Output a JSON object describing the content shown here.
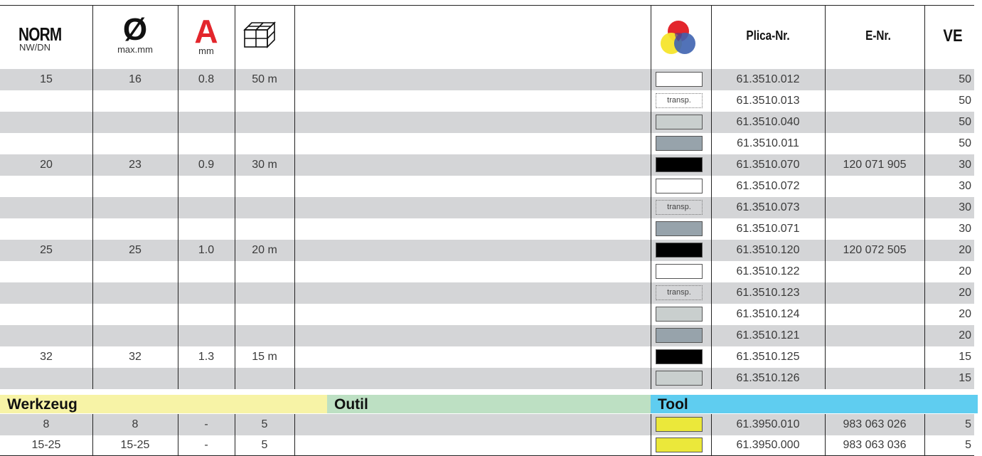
{
  "header": {
    "norm": "NORM",
    "norm_sub": "NW/DN",
    "diameter_symbol": "Ø",
    "diameter_sub": "max.mm",
    "wall_symbol": "A",
    "wall_sub": "mm",
    "length_icon": "box-icon",
    "color_icon": "color-circles-icon",
    "plica": "Plica-Nr.",
    "enr": "E-Nr.",
    "ve": "VE"
  },
  "rows": [
    {
      "nw": "15",
      "max": "16",
      "a": "0.8",
      "len": "50 m",
      "color": "white",
      "plica": "61.3510.012",
      "enr": "",
      "ve": "50"
    },
    {
      "nw": "",
      "max": "",
      "a": "",
      "len": "",
      "color": "transp.",
      "plica": "61.3510.013",
      "enr": "",
      "ve": "50"
    },
    {
      "nw": "",
      "max": "",
      "a": "",
      "len": "",
      "color": "light-grey",
      "plica": "61.3510.040",
      "enr": "",
      "ve": "50"
    },
    {
      "nw": "",
      "max": "",
      "a": "",
      "len": "",
      "color": "grey",
      "plica": "61.3510.011",
      "enr": "",
      "ve": "50"
    },
    {
      "nw": "20",
      "max": "23",
      "a": "0.9",
      "len": "30 m",
      "color": "black",
      "plica": "61.3510.070",
      "enr": "120 071 905",
      "ve": "30"
    },
    {
      "nw": "",
      "max": "",
      "a": "",
      "len": "",
      "color": "white",
      "plica": "61.3510.072",
      "enr": "",
      "ve": "30"
    },
    {
      "nw": "",
      "max": "",
      "a": "",
      "len": "",
      "color": "transp.",
      "plica": "61.3510.073",
      "enr": "",
      "ve": "30"
    },
    {
      "nw": "",
      "max": "",
      "a": "",
      "len": "",
      "color": "grey",
      "plica": "61.3510.071",
      "enr": "",
      "ve": "30"
    },
    {
      "nw": "25",
      "max": "25",
      "a": "1.0",
      "len": "20 m",
      "color": "black",
      "plica": "61.3510.120",
      "enr": "120 072 505",
      "ve": "20"
    },
    {
      "nw": "",
      "max": "",
      "a": "",
      "len": "",
      "color": "white",
      "plica": "61.3510.122",
      "enr": "",
      "ve": "20"
    },
    {
      "nw": "",
      "max": "",
      "a": "",
      "len": "",
      "color": "transp.",
      "plica": "61.3510.123",
      "enr": "",
      "ve": "20"
    },
    {
      "nw": "",
      "max": "",
      "a": "",
      "len": "",
      "color": "light-grey",
      "plica": "61.3510.124",
      "enr": "",
      "ve": "20"
    },
    {
      "nw": "",
      "max": "",
      "a": "",
      "len": "",
      "color": "grey",
      "plica": "61.3510.121",
      "enr": "",
      "ve": "20"
    },
    {
      "nw": "32",
      "max": "32",
      "a": "1.3",
      "len": "15 m",
      "color": "black",
      "plica": "61.3510.125",
      "enr": "",
      "ve": "15"
    },
    {
      "nw": "",
      "max": "",
      "a": "",
      "len": "",
      "color": "light-grey",
      "plica": "61.3510.126",
      "enr": "",
      "ve": "15"
    }
  ],
  "sections": {
    "de": "Werkzeug",
    "fr": "Outil",
    "en": "Tool",
    "de_color": "#f7f3a6",
    "fr_color": "#bde0c3",
    "en_color": "#5fcdf0"
  },
  "tool_rows": [
    {
      "nw": "8",
      "max": "8",
      "a": "-",
      "len": "5",
      "color": "yellow",
      "plica": "61.3950.010",
      "enr": "983 063 026",
      "ve": "5"
    },
    {
      "nw": "15-25",
      "max": "15-25",
      "a": "-",
      "len": "5",
      "color": "yellow",
      "plica": "61.3950.000",
      "enr": "983 063 036",
      "ve": "5"
    }
  ],
  "swatch_colors": {
    "white": "#ffffff",
    "light-grey": "#c9cfce",
    "grey": "#97a3ab",
    "black": "#000000",
    "yellow": "#ebe83a"
  },
  "accent": {
    "red": "#e3262c",
    "yellow": "#f5e52c",
    "blue": "#3e63b0"
  }
}
